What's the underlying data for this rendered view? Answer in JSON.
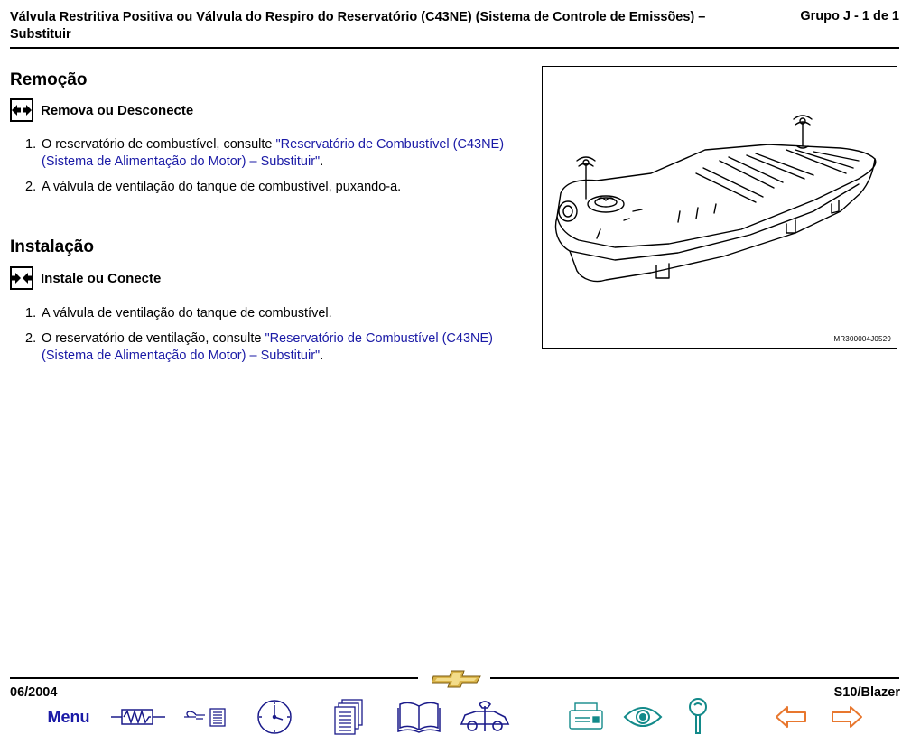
{
  "header": {
    "title": "Válvula Restritiva Positiva ou Válvula do Respiro do Reservatório (C43NE) (Sistema de Controle de Emissões) – Substituir",
    "page_indicator": "Grupo J - 1 de 1"
  },
  "removal": {
    "heading": "Remoção",
    "subheading": "Remova ou Desconecte",
    "steps": [
      {
        "num": "1.",
        "text": "O reservatório de combustível, consulte ",
        "link": "\"Reservatório de Combustível (C43NE) (Sistema de Alimentação do Motor) – Substituir\"",
        "tail": "."
      },
      {
        "num": "2.",
        "text": "A válvula de ventilação do tanque de combustível, puxando-a."
      }
    ]
  },
  "installation": {
    "heading": "Instalação",
    "subheading": "Instale ou Conecte",
    "steps": [
      {
        "num": "1.",
        "text": "A válvula de ventilação do tanque de combustível."
      },
      {
        "num": "2.",
        "text": "O reservatório de ventilação, consulte ",
        "link": "\"Reservatório de Combustível (C43NE) (Sistema de Alimentação do Motor) – Substituir\"",
        "tail": "."
      }
    ]
  },
  "figure": {
    "code": "MR300004J0529"
  },
  "footer": {
    "date": "06/2004",
    "model": "S10/Blazer",
    "menu_label": "Menu"
  },
  "colors": {
    "link": "#1a1aa6",
    "nav_blue": "#1a1a8a",
    "nav_teal": "#138a8a",
    "nav_orange": "#e8772e",
    "bowtie_gold": "#d9b44a"
  },
  "icons": [
    "remove-arrows-icon",
    "install-arrows-icon",
    "wiring-diagram-icon",
    "reference-note-icon",
    "clock-icon",
    "documents-icon",
    "book-icon",
    "service-car-icon",
    "printer-icon",
    "eye-icon",
    "magnifier-icon",
    "previous-page-arrow-icon",
    "next-page-arrow-icon",
    "chevrolet-bowtie-logo"
  ]
}
